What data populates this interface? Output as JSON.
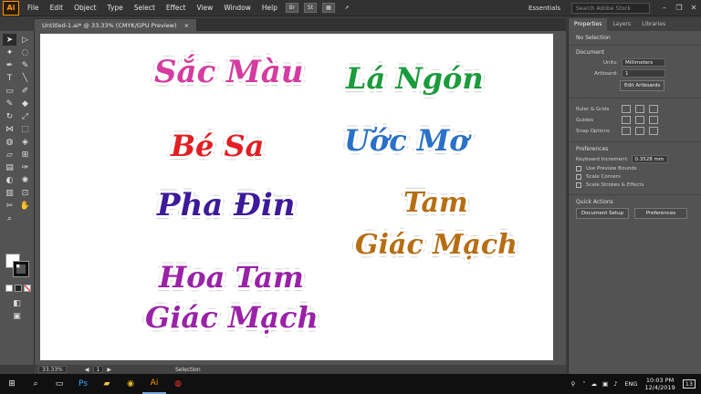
{
  "menubar": {
    "logo": "Ai",
    "items": [
      "File",
      "Edit",
      "Object",
      "Type",
      "Select",
      "Effect",
      "View",
      "Window",
      "Help"
    ],
    "bridge_icon": "Br",
    "stock_icon": "St",
    "workspace": "Essentials",
    "stock_placeholder": "Search Adobe Stock",
    "win_min": "–",
    "win_max": "❐",
    "win_close": "✕"
  },
  "document_tab": {
    "title": "Untitled-1.ai* @ 33.33% (CMYK/GPU Preview)",
    "close": "×"
  },
  "artwork": {
    "t1": "Sắc Màu",
    "t2": "Lá Ngón",
    "t3": "Bé Sa",
    "t4": "Ước Mơ",
    "t5": "Pha Đin",
    "t6a": "Tam",
    "t6b": "Giác Mạch",
    "t7a": "Hoa Tam",
    "t7b": "Giác Mạch"
  },
  "status": {
    "zoom": "33.33%",
    "artboard_num": "1",
    "tool": "Selection"
  },
  "panel": {
    "tabs": [
      "Properties",
      "Layers",
      "Libraries"
    ],
    "selection": "No Selection",
    "document_heading": "Document",
    "units_label": "Units:",
    "units_value": "Millimeters",
    "artboard_label": "Artboard:",
    "artboard_value": "1",
    "edit_artboards": "Edit Artboards",
    "ruler_grids": "Ruler & Grids",
    "guides": "Guides",
    "snap_options": "Snap Options",
    "preferences_heading": "Preferences",
    "keyboard_increment_label": "Keyboard Increment:",
    "keyboard_increment_value": "0.3528 mm",
    "use_preview_bounds": "Use Preview Bounds",
    "scale_corners": "Scale Corners",
    "scale_strokes": "Scale Strokes & Effects",
    "quick_actions": "Quick Actions",
    "document_setup": "Document Setup",
    "preferences_btn": "Preferences"
  },
  "taskbar": {
    "lang": "ENG",
    "time": "10:03 PM",
    "date": "12/4/2019",
    "notif_count": "13"
  },
  "colors": {
    "menubar": "#323232",
    "panel": "#535353",
    "accent_ai": "#ff9a00"
  }
}
